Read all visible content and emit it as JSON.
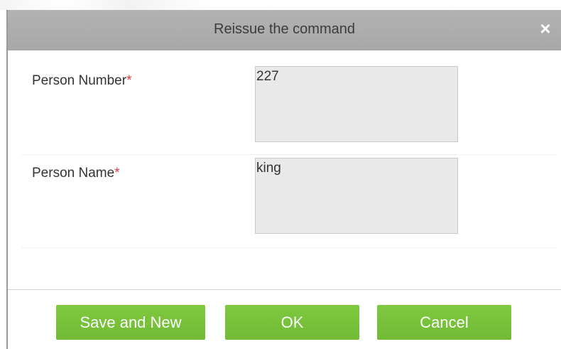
{
  "dialog": {
    "title": "Reissue the command",
    "close_icon": "close-icon",
    "close_glyph": "×"
  },
  "form": {
    "fields": [
      {
        "label": "Person Number",
        "required_mark": "*",
        "value": "227"
      },
      {
        "label": "Person Name",
        "required_mark": "*",
        "value": "king"
      }
    ]
  },
  "buttons": {
    "save_and_new": "Save and New",
    "ok": "OK",
    "cancel": "Cancel"
  },
  "colors": {
    "header_bg": "#acacac",
    "button_bg": "#78c33a",
    "required": "#e23b3b",
    "input_bg": "#e9e9e9"
  }
}
